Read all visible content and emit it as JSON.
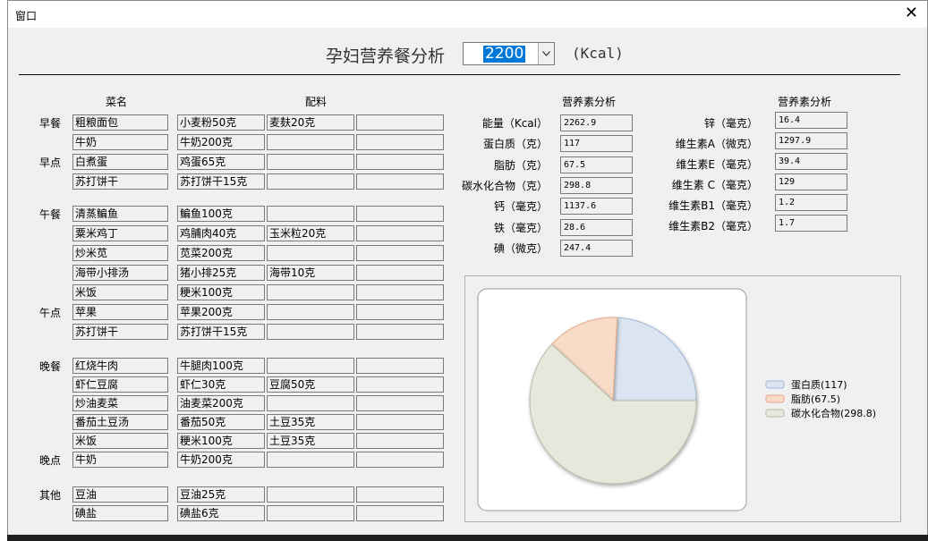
{
  "window": {
    "title": "窗口",
    "close_glyph": "✕"
  },
  "header": {
    "title": "孕妇营养餐分析",
    "kcal_value": "2200",
    "unit": "(Kcal)"
  },
  "columns": {
    "dish": "菜名",
    "ingredients": "配料",
    "nutrients_a": "营养素分析",
    "nutrients_b": "营养素分析"
  },
  "meal_categories": [
    {
      "label": "早餐"
    },
    {
      "label": "早点"
    },
    {
      "label": "午餐"
    },
    {
      "label": "午点"
    },
    {
      "label": "晚餐"
    },
    {
      "label": "晚点"
    },
    {
      "label": "其他"
    }
  ],
  "rows": [
    {
      "dish": "粗粮面包",
      "ing": [
        "小麦粉50克",
        "麦麸20克",
        ""
      ]
    },
    {
      "dish": "牛奶",
      "ing": [
        "牛奶200克",
        "",
        ""
      ]
    },
    {
      "dish": "白煮蛋",
      "ing": [
        "鸡蛋65克",
        "",
        ""
      ]
    },
    {
      "dish": "苏打饼干",
      "ing": [
        "苏打饼干15克",
        "",
        ""
      ]
    },
    {
      "dish": "清蒸鳊鱼",
      "ing": [
        "鳊鱼100克",
        "",
        ""
      ]
    },
    {
      "dish": "粟米鸡丁",
      "ing": [
        "鸡脯肉40克",
        "玉米粒20克",
        ""
      ]
    },
    {
      "dish": "炒米苋",
      "ing": [
        "苋菜200克",
        "",
        ""
      ]
    },
    {
      "dish": "海带小排汤",
      "ing": [
        "猪小排25克",
        "海带10克",
        ""
      ]
    },
    {
      "dish": "米饭",
      "ing": [
        "粳米100克",
        "",
        ""
      ]
    },
    {
      "dish": "苹果",
      "ing": [
        "苹果200克",
        "",
        ""
      ]
    },
    {
      "dish": "苏打饼干",
      "ing": [
        "苏打饼干15克",
        "",
        ""
      ]
    },
    {
      "dish": "红烧牛肉",
      "ing": [
        "牛腿肉100克",
        "",
        ""
      ]
    },
    {
      "dish": "虾仁豆腐",
      "ing": [
        "虾仁30克",
        "豆腐50克",
        ""
      ]
    },
    {
      "dish": "炒油麦菜",
      "ing": [
        "油麦菜200克",
        "",
        ""
      ]
    },
    {
      "dish": "番茄土豆汤",
      "ing": [
        "番茄50克",
        "土豆35克",
        ""
      ]
    },
    {
      "dish": "米饭",
      "ing": [
        "粳米100克",
        "土豆35克",
        ""
      ]
    },
    {
      "dish": "牛奶",
      "ing": [
        "牛奶200克",
        "",
        ""
      ]
    },
    {
      "dish": "豆油",
      "ing": [
        "豆油25克",
        "",
        ""
      ]
    },
    {
      "dish": "碘盐",
      "ing": [
        "碘盐6克",
        "",
        ""
      ]
    }
  ],
  "nutrients_left": [
    {
      "label": "能量（Kcal）",
      "value": "2262.9"
    },
    {
      "label": "蛋白质（克）",
      "value": "117"
    },
    {
      "label": "脂肪（克）",
      "value": "67.5"
    },
    {
      "label": "碳水化合物（克）",
      "value": "298.8"
    },
    {
      "label": "钙（毫克）",
      "value": "1137.6"
    },
    {
      "label": "铁（毫克）",
      "value": "28.6"
    },
    {
      "label": "碘（微克）",
      "value": "247.4"
    }
  ],
  "nutrients_right": [
    {
      "label": "锌（毫克）",
      "value": "16.4"
    },
    {
      "label": "维生素A（微克）",
      "value": "1297.9"
    },
    {
      "label": "维生素E（毫克）",
      "value": "39.4"
    },
    {
      "label": "维生素 C（毫克）",
      "value": "129"
    },
    {
      "label": "维生素B1（毫克）",
      "value": "1.2"
    },
    {
      "label": "维生素B2（毫克）",
      "value": "1.7"
    }
  ],
  "chart_data": {
    "type": "pie",
    "title": "",
    "series": [
      {
        "name": "蛋白质(117)",
        "value": 117,
        "color": "#dbe5f1",
        "stroke": "#9fb7d6"
      },
      {
        "name": "脂肪(67.5)",
        "value": 67.5,
        "color": "#f8dcc8",
        "stroke": "#e6a987"
      },
      {
        "name": "碳水化合物(298.8)",
        "value": 298.8,
        "color": "#e6e8dc",
        "stroke": "#b8bca8"
      }
    ],
    "legend_position": "right"
  }
}
